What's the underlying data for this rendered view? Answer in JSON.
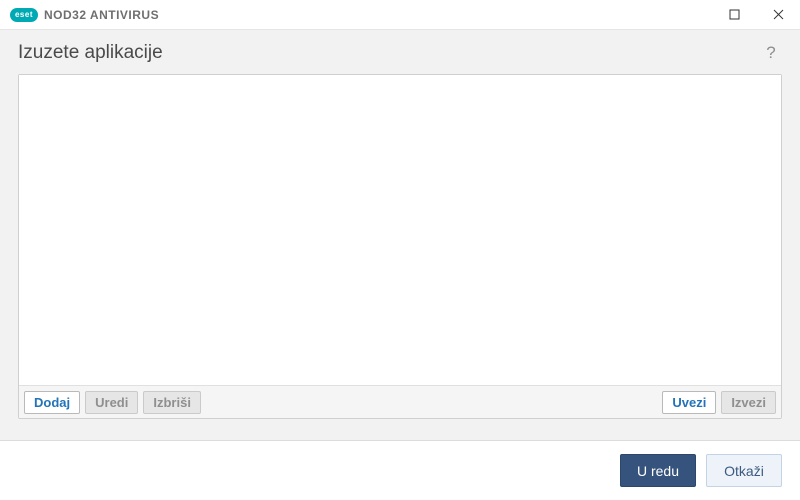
{
  "titlebar": {
    "brand_badge": "eset",
    "product_name": "NOD32 ANTIVIRUS"
  },
  "header": {
    "title": "Izuzete aplikacije",
    "help": "?"
  },
  "toolbar": {
    "add": "Dodaj",
    "edit": "Uredi",
    "delete": "Izbriši",
    "import": "Uvezi",
    "export": "Izvezi"
  },
  "footer": {
    "ok": "U redu",
    "cancel": "Otkaži"
  },
  "list": {
    "items": []
  }
}
